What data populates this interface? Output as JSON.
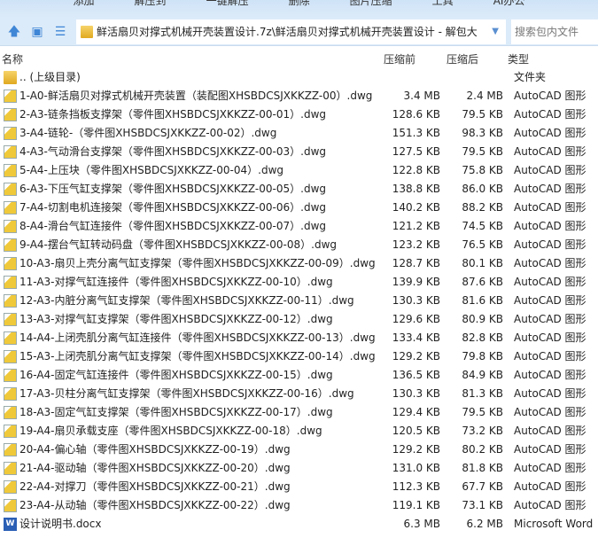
{
  "toolbar": [
    "添加",
    "解压到",
    "一键解压",
    "删除",
    "图片压缩",
    "工具",
    "AI办公"
  ],
  "address": "鲜活扇贝对撑式机械开壳装置设计.7z\\鲜活扇贝对撑式机械开壳装置设计 - 解包大",
  "search_placeholder": "搜索包内文件",
  "columns": {
    "name": "名称",
    "before": "压缩前",
    "after": "压缩后",
    "type": "类型"
  },
  "rows": [
    {
      "icon": "folder",
      "name": ".. (上级目录)",
      "before": "",
      "after": "",
      "type": "文件夹"
    },
    {
      "icon": "dwg",
      "name": "1-A0-鲜活扇贝对撑式机械开壳装置（装配图XHSBDCSJXKKZZ-00）.dwg",
      "before": "3.4 MB",
      "after": "2.4 MB",
      "type": "AutoCAD 图形"
    },
    {
      "icon": "dwg",
      "name": "2-A3-链条挡板支撑架（零件图XHSBDCSJXKKZZ-00-01）.dwg",
      "before": "128.6 KB",
      "after": "79.5 KB",
      "type": "AutoCAD 图形"
    },
    {
      "icon": "dwg",
      "name": "3-A4-链轮-（零件图XHSBDCSJXKKZZ-00-02）.dwg",
      "before": "151.3 KB",
      "after": "98.3 KB",
      "type": "AutoCAD 图形"
    },
    {
      "icon": "dwg",
      "name": "4-A3-气动滑台支撑架（零件图XHSBDCSJXKKZZ-00-03）.dwg",
      "before": "127.5 KB",
      "after": "79.5 KB",
      "type": "AutoCAD 图形"
    },
    {
      "icon": "dwg",
      "name": "5-A4-上压块（零件图XHSBDCSJXKKZZ-00-04）.dwg",
      "before": "122.8 KB",
      "after": "75.8 KB",
      "type": "AutoCAD 图形"
    },
    {
      "icon": "dwg",
      "name": "6-A3-下压气缸支撑架（零件图XHSBDCSJXKKZZ-00-05）.dwg",
      "before": "138.8 KB",
      "after": "86.0 KB",
      "type": "AutoCAD 图形"
    },
    {
      "icon": "dwg",
      "name": "7-A4-切割电机连接架（零件图XHSBDCSJXKKZZ-00-06）.dwg",
      "before": "140.2 KB",
      "after": "88.2 KB",
      "type": "AutoCAD 图形"
    },
    {
      "icon": "dwg",
      "name": "8-A4-滑台气缸连接件（零件图XHSBDCSJXKKZZ-00-07）.dwg",
      "before": "121.2 KB",
      "after": "74.5 KB",
      "type": "AutoCAD 图形"
    },
    {
      "icon": "dwg",
      "name": "9-A4-摆台气缸转动码盘（零件图XHSBDCSJXKKZZ-00-08）.dwg",
      "before": "123.2 KB",
      "after": "76.5 KB",
      "type": "AutoCAD 图形"
    },
    {
      "icon": "dwg",
      "name": "10-A3-扇贝上壳分离气缸支撑架（零件图XHSBDCSJXKKZZ-00-09）.dwg",
      "before": "128.7 KB",
      "after": "80.1 KB",
      "type": "AutoCAD 图形"
    },
    {
      "icon": "dwg",
      "name": "11-A3-对撑气缸连接件（零件图XHSBDCSJXKKZZ-00-10）.dwg",
      "before": "139.9 KB",
      "after": "87.6 KB",
      "type": "AutoCAD 图形"
    },
    {
      "icon": "dwg",
      "name": "12-A3-内脏分离气缸支撑架（零件图XHSBDCSJXKKZZ-00-11）.dwg",
      "before": "130.3 KB",
      "after": "81.6 KB",
      "type": "AutoCAD 图形"
    },
    {
      "icon": "dwg",
      "name": "13-A3-对撑气缸支撑架（零件图XHSBDCSJXKKZZ-00-12）.dwg",
      "before": "129.6 KB",
      "after": "80.9 KB",
      "type": "AutoCAD 图形"
    },
    {
      "icon": "dwg",
      "name": "14-A4-上闭壳肌分离气缸连接件（零件图XHSBDCSJXKKZZ-00-13）.dwg",
      "before": "133.4 KB",
      "after": "82.8 KB",
      "type": "AutoCAD 图形"
    },
    {
      "icon": "dwg",
      "name": "15-A3-上闭壳肌分离气缸支撑架（零件图XHSBDCSJXKKZZ-00-14）.dwg",
      "before": "129.2 KB",
      "after": "79.8 KB",
      "type": "AutoCAD 图形"
    },
    {
      "icon": "dwg",
      "name": "16-A4-固定气缸连接件（零件图XHSBDCSJXKKZZ-00-15）.dwg",
      "before": "136.5 KB",
      "after": "84.9 KB",
      "type": "AutoCAD 图形"
    },
    {
      "icon": "dwg",
      "name": "17-A3-贝柱分离气缸支撑架（零件图XHSBDCSJXKKZZ-00-16）.dwg",
      "before": "130.3 KB",
      "after": "81.3 KB",
      "type": "AutoCAD 图形"
    },
    {
      "icon": "dwg",
      "name": "18-A3-固定气缸支撑架（零件图XHSBDCSJXKKZZ-00-17）.dwg",
      "before": "129.4 KB",
      "after": "79.5 KB",
      "type": "AutoCAD 图形"
    },
    {
      "icon": "dwg",
      "name": "19-A4-扇贝承载支座（零件图XHSBDCSJXKKZZ-00-18）.dwg",
      "before": "120.5 KB",
      "after": "73.2 KB",
      "type": "AutoCAD 图形"
    },
    {
      "icon": "dwg",
      "name": "20-A4-偏心轴（零件图XHSBDCSJXKKZZ-00-19）.dwg",
      "before": "129.2 KB",
      "after": "80.2 KB",
      "type": "AutoCAD 图形"
    },
    {
      "icon": "dwg",
      "name": "21-A4-驱动轴（零件图XHSBDCSJXKKZZ-00-20）.dwg",
      "before": "131.0 KB",
      "after": "81.8 KB",
      "type": "AutoCAD 图形"
    },
    {
      "icon": "dwg",
      "name": "22-A4-对撑刀（零件图XHSBDCSJXKKZZ-00-21）.dwg",
      "before": "112.3 KB",
      "after": "67.7 KB",
      "type": "AutoCAD 图形"
    },
    {
      "icon": "dwg",
      "name": "23-A4-从动轴（零件图XHSBDCSJXKKZZ-00-22）.dwg",
      "before": "119.1 KB",
      "after": "73.1 KB",
      "type": "AutoCAD 图形"
    },
    {
      "icon": "doc",
      "name": "设计说明书.docx",
      "before": "6.3 MB",
      "after": "6.2 MB",
      "type": "Microsoft Word"
    }
  ]
}
